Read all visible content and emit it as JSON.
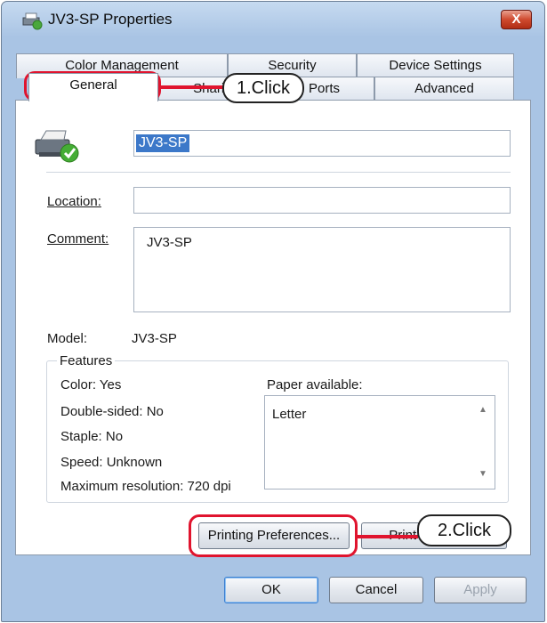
{
  "window": {
    "title": "JV3-SP Properties",
    "close_label": "X"
  },
  "tabs_back": [
    "Color Management",
    "Security",
    "Device Settings"
  ],
  "tabs_front": [
    "General",
    "Sharing",
    "Ports",
    "Advanced"
  ],
  "general": {
    "printer_name": "JV3-SP",
    "location_label": "Location:",
    "location_value": "",
    "comment_label": "Comment:",
    "comment_value": "JV3-SP",
    "model_label": "Model:",
    "model_value": "JV3-SP"
  },
  "features": {
    "title": "Features",
    "color": "Color: Yes",
    "double_sided": "Double-sided: No",
    "staple": "Staple: No",
    "speed": "Speed: Unknown",
    "max_resolution": "Maximum resolution: 720 dpi",
    "paper_label": "Paper available:",
    "paper_items": [
      "Letter"
    ]
  },
  "buttons": {
    "printing_preferences": "Printing Preferences...",
    "print_test_page": "Print Test Page",
    "ok": "OK",
    "cancel": "Cancel",
    "apply": "Apply"
  },
  "annotations": {
    "step1": "1.Click",
    "step2": "2.Click",
    "accent": "#e0142e"
  }
}
